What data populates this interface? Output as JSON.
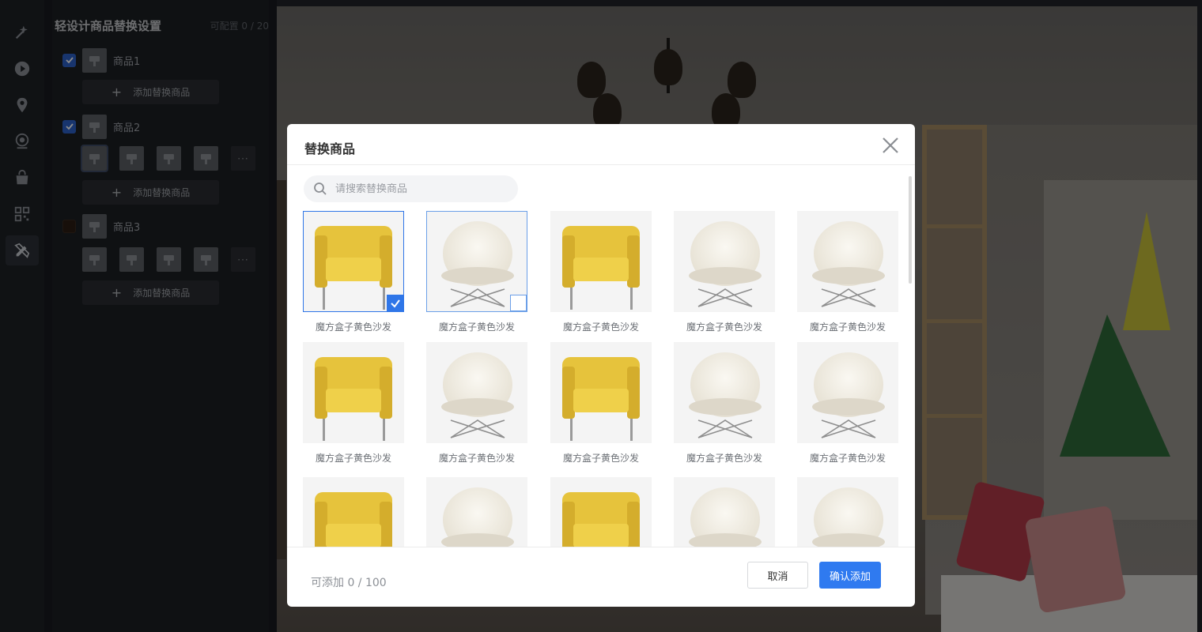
{
  "rail": {
    "items": [
      {
        "icon": "magic-wand-icon"
      },
      {
        "icon": "play-icon"
      },
      {
        "icon": "location-pin-icon"
      },
      {
        "icon": "camera-eye-icon"
      },
      {
        "icon": "shopping-bag-icon"
      },
      {
        "icon": "qr-code-icon"
      },
      {
        "icon": "design-tools-icon",
        "active": true
      }
    ]
  },
  "panel": {
    "title": "轻设计商品替换设置",
    "count": "可配置 0 / 20",
    "add_label": "添加替换商品",
    "more_label": "···",
    "products": [
      {
        "name": "商品1",
        "checked": true
      },
      {
        "name": "商品2",
        "checked": true
      },
      {
        "name": "商品3",
        "checked": false
      }
    ]
  },
  "modal": {
    "title": "替换商品",
    "search_placeholder": "请搜索替换商品",
    "cards": [
      {
        "label": "魔方盒子黄色沙发",
        "type": "yellow",
        "state": "selected"
      },
      {
        "label": "魔方盒子黄色沙发",
        "type": "white",
        "state": "hover"
      },
      {
        "label": "魔方盒子黄色沙发",
        "type": "yellow"
      },
      {
        "label": "魔方盒子黄色沙发",
        "type": "white"
      },
      {
        "label": "魔方盒子黄色沙发",
        "type": "white"
      },
      {
        "label": "魔方盒子黄色沙发",
        "type": "yellow"
      },
      {
        "label": "魔方盒子黄色沙发",
        "type": "white"
      },
      {
        "label": "魔方盒子黄色沙发",
        "type": "yellow"
      },
      {
        "label": "魔方盒子黄色沙发",
        "type": "white"
      },
      {
        "label": "魔方盒子黄色沙发",
        "type": "white"
      },
      {
        "type": "yellow"
      },
      {
        "type": "white"
      },
      {
        "type": "yellow"
      },
      {
        "type": "white"
      },
      {
        "type": "white"
      }
    ],
    "footer_count": "可添加 0 / 100",
    "cancel_label": "取消",
    "confirm_label": "确认添加"
  },
  "colors": {
    "primary": "#2f7af0",
    "panel_bg": "#1c1f23",
    "rail_bg": "#1e2126"
  }
}
